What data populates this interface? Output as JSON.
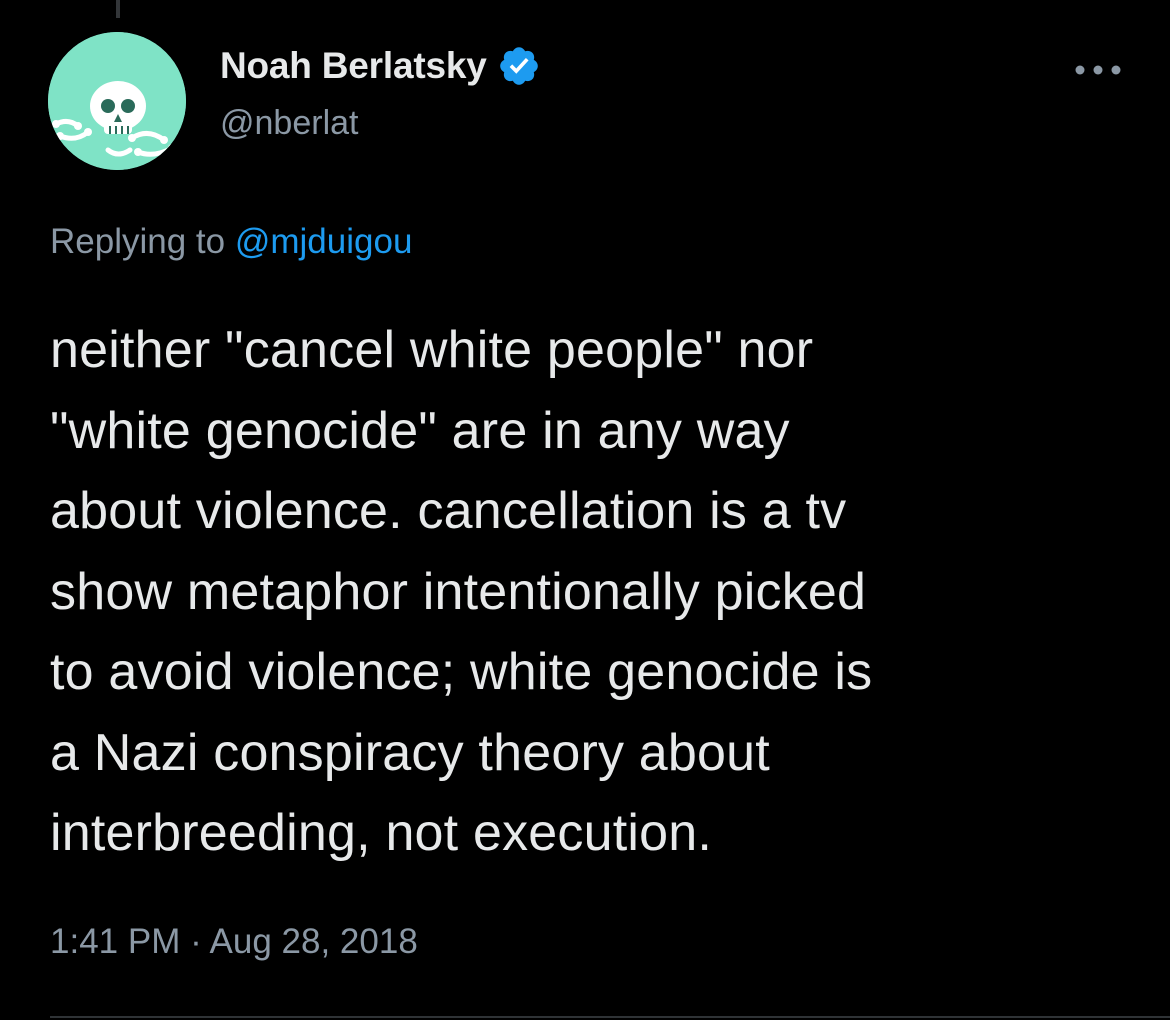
{
  "tweet": {
    "author": {
      "display_name": "Noah Berlatsky",
      "handle": "@nberlat",
      "verified": true
    },
    "reply": {
      "prefix": "Replying to",
      "mention": "@mjduigou"
    },
    "text_lines": [
      "neither \"cancel white people\" nor",
      "\"white genocide\" are in any way",
      "about violence. cancellation is a tv",
      "show metaphor intentionally picked",
      "to avoid violence; white genocide is",
      "a Nazi conspiracy theory about",
      "interbreeding, not execution."
    ],
    "timestamp": {
      "time": "1:41 PM",
      "separator": "·",
      "date": "Aug 28, 2018"
    }
  },
  "icons": {
    "verified": "verified-badge-icon",
    "more": "more-options-icon",
    "avatar": "skull-avatar-image"
  },
  "colors": {
    "background": "#000000",
    "text_primary": "#e7e9ea",
    "text_secondary": "#8b98a5",
    "accent": "#1d9bf0",
    "avatar_bg": "#7fe3c6",
    "divider": "#2f3336"
  }
}
